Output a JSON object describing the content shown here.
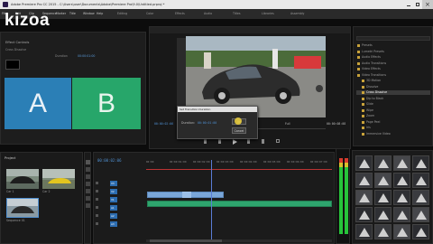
{
  "logo": "kizoa",
  "window": {
    "title": "Adobe Premiere Pro CC 2015 - C:\\Users\\user\\Documents\\Adobe\\Premiere Pro\\9.0\\Untitled.prproj *",
    "menu": [
      "File",
      "Edit",
      "Clip",
      "Sequence",
      "Marker",
      "Title",
      "Window",
      "Help"
    ],
    "workspaces": [
      "Editing",
      "Color",
      "Effects",
      "Audio",
      "Titles",
      "Libraries",
      "Assembly"
    ]
  },
  "effect_controls": {
    "title": "Effect Controls",
    "label_a": "A",
    "label_b": "B",
    "transition_name": "Cross Dissolve",
    "duration_label": "Duration",
    "duration_value": "00:00:01:00"
  },
  "program_monitor": {
    "timecode_left": "00:00:02:06",
    "timecode_right": "00:00:08:08",
    "fit_label": "Full"
  },
  "dialog": {
    "title": "Set Transition Duration",
    "duration_label": "Duration:",
    "duration_value": "00:00:01:00",
    "ok_label": "OK",
    "cancel_label": "Cancel"
  },
  "effects_panel": {
    "items": [
      "Presets",
      "Lumetri Presets",
      "Audio Effects",
      "Audio Transitions",
      "Video Effects",
      "Video Transitions",
      "3D Motion",
      "Dissolve",
      "Cross Dissolve",
      "Dip to Black",
      "Slide",
      "Wipe",
      "Zoom",
      "Page Peel",
      "Iris",
      "Immersive Video"
    ]
  },
  "project_panel": {
    "title": "Project",
    "clips": [
      "Car 1",
      "Car 2",
      "Sequence 01"
    ]
  },
  "timeline": {
    "timecode": "00:00:02:06",
    "ruler": [
      "00:00",
      "00:00:01:00",
      "00:00:02:00",
      "00:00:03:00",
      "00:00:04:00",
      "00:00:05:00",
      "00:00:06:00",
      "00:00:07:00"
    ],
    "tracks": [
      "V3",
      "V2",
      "V1",
      "A1",
      "A2",
      "A3"
    ]
  },
  "colors": {
    "accent": "#2d8ceb",
    "clip_video": "#7aa6d8",
    "clip_audio": "#2ea56e",
    "transition_a": "#2b7fb6",
    "transition_b": "#27a66a",
    "meter_green": "#27c43a",
    "meter_red": "#d63b2e",
    "playhead": "#5a7cd6"
  }
}
